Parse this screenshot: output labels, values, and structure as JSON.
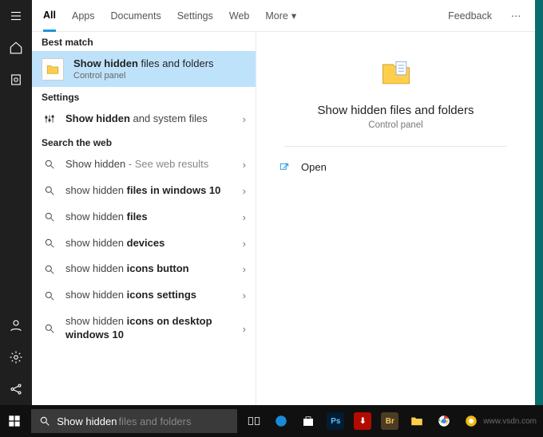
{
  "tabs": {
    "items": [
      "All",
      "Apps",
      "Documents",
      "Settings",
      "Web",
      "More"
    ],
    "active_index": 0,
    "feedback": "Feedback"
  },
  "sections": {
    "best_match": "Best match",
    "settings": "Settings",
    "search_web": "Search the web"
  },
  "best_match_item": {
    "title_pre": "Show hidden",
    "title_post": " files and folders",
    "sub": "Control panel"
  },
  "settings_items": [
    {
      "pre": "Show hidden",
      "bold": " and system files"
    }
  ],
  "web_items": [
    {
      "pre": "Show hidden",
      "bold": "",
      "muted": " - See web results"
    },
    {
      "pre": "show hidden ",
      "bold": "files in windows 10"
    },
    {
      "pre": "show hidden ",
      "bold": "files"
    },
    {
      "pre": "show hidden ",
      "bold": "devices"
    },
    {
      "pre": "show hidden ",
      "bold": "icons button"
    },
    {
      "pre": "show hidden ",
      "bold": "icons settings"
    },
    {
      "pre": "show hidden ",
      "bold": "icons on desktop windows 10"
    }
  ],
  "preview": {
    "title": "Show hidden files and folders",
    "sub": "Control panel",
    "open": "Open"
  },
  "search": {
    "typed": "Show hidden",
    "ghost": " files and folders"
  },
  "watermark": "www.vsdn.com"
}
